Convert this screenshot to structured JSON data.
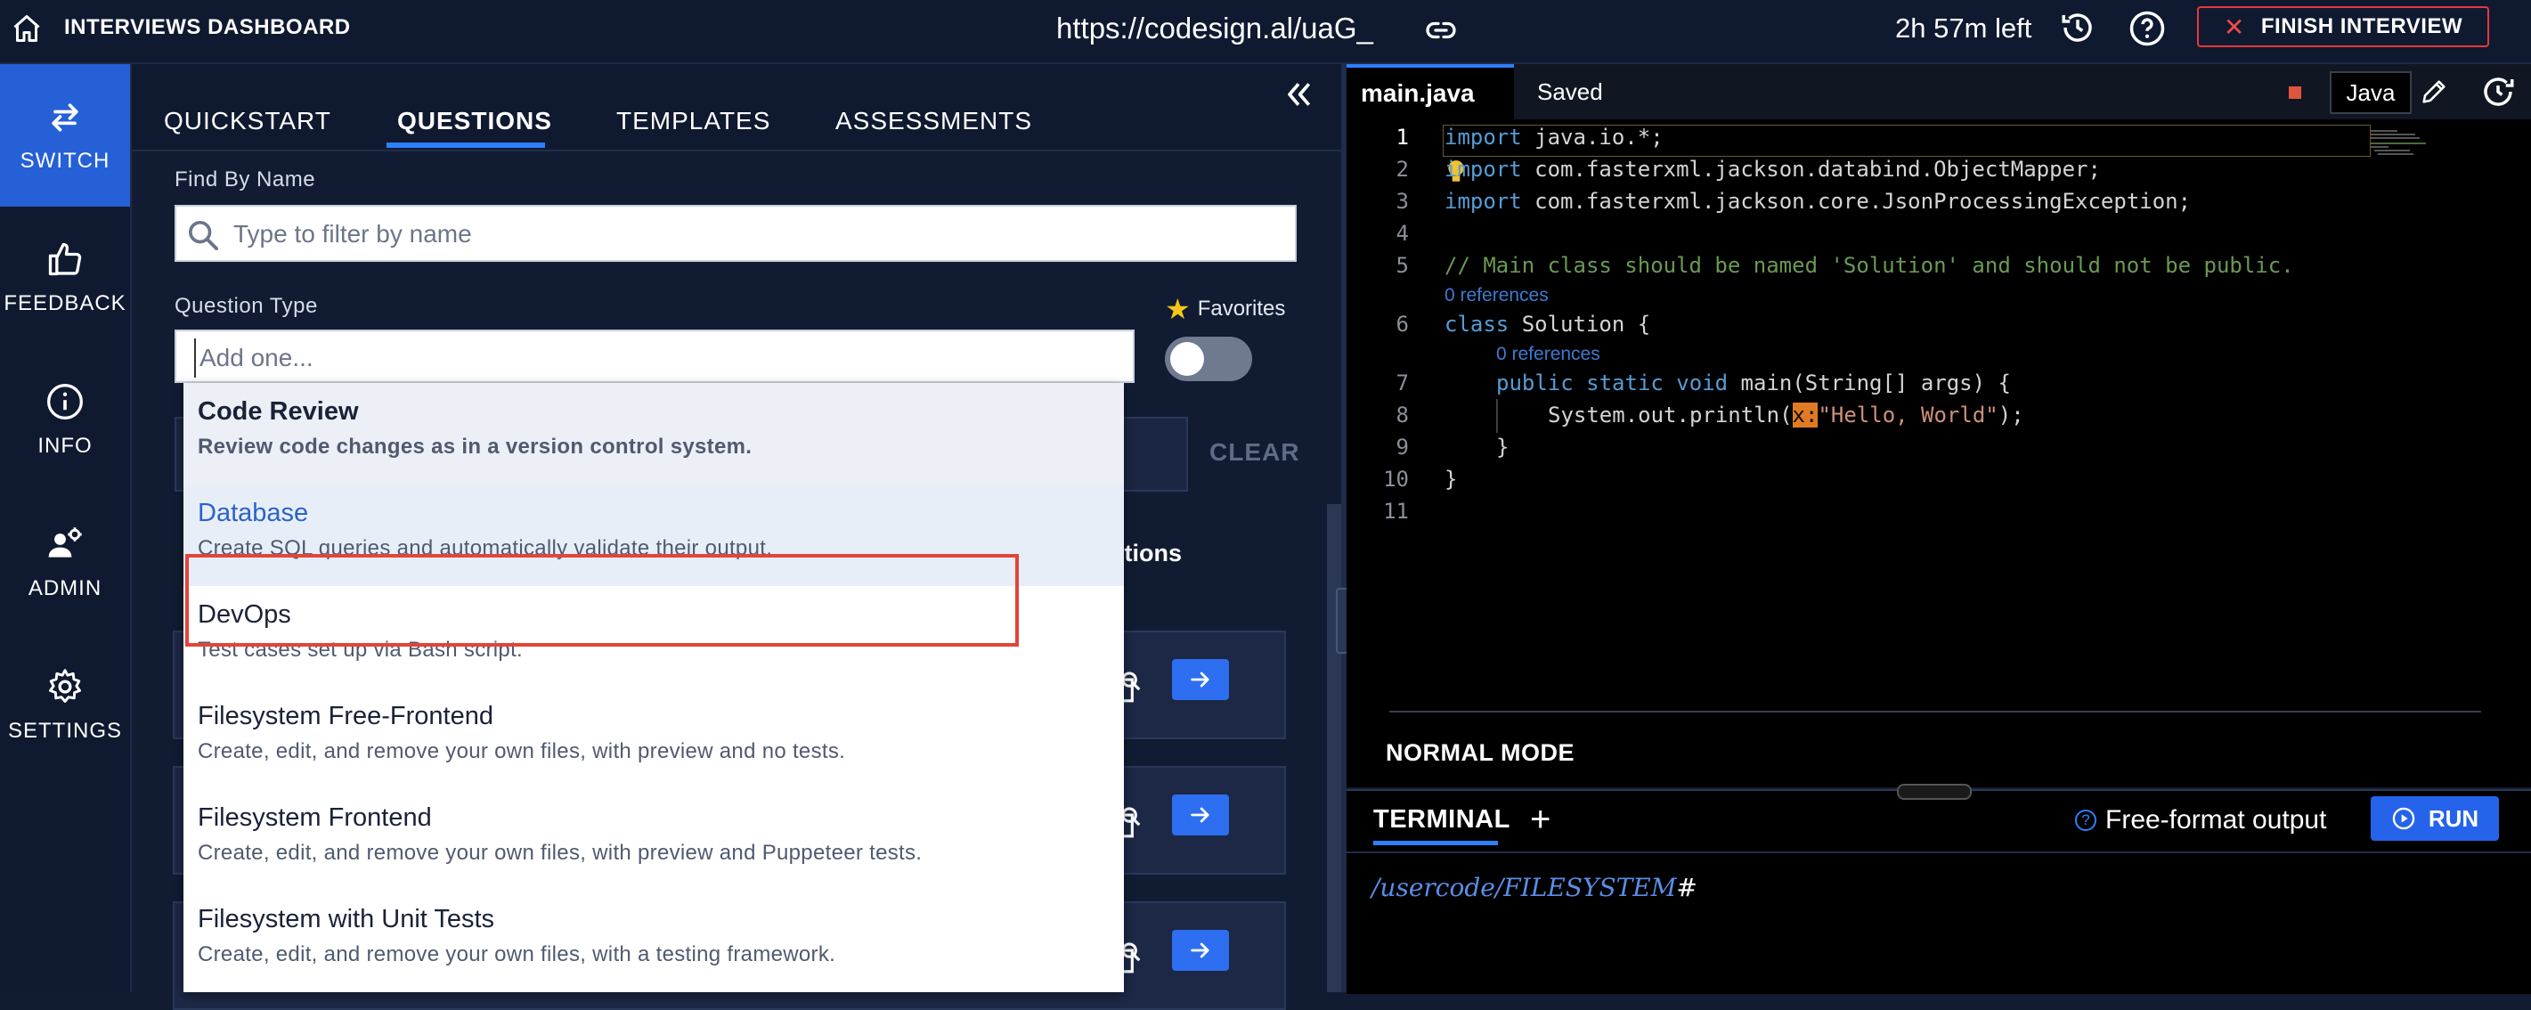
{
  "header": {
    "app_title": "INTERVIEWS DASHBOARD",
    "url": "https://codesign.al/uaG_",
    "time_left": "2h 57m left",
    "finish_label": "FINISH INTERVIEW",
    "finish_icon": "close-icon"
  },
  "rail": {
    "items": [
      {
        "label": "SWITCH",
        "icon": "switch-arrows-icon",
        "active": true
      },
      {
        "label": "FEEDBACK",
        "icon": "thumbs-up-icon"
      },
      {
        "label": "INFO",
        "icon": "info-icon"
      },
      {
        "label": "ADMIN",
        "icon": "admin-gear-user-icon"
      },
      {
        "label": "SETTINGS",
        "icon": "gear-icon"
      }
    ]
  },
  "panel": {
    "tabs": [
      {
        "label": "QUICKSTART"
      },
      {
        "label": "QUESTIONS",
        "active": true
      },
      {
        "label": "TEMPLATES"
      },
      {
        "label": "ASSESSMENTS"
      }
    ],
    "find_label": "Find By Name",
    "search_placeholder": "Type to filter by name",
    "question_type_label": "Question Type",
    "type_placeholder": "Add one...",
    "favorites_label": "Favorites",
    "favorites_on": false,
    "clear_label": "CLEAR",
    "actions_label": "Actions",
    "options": [
      {
        "title": "Code Review",
        "desc": "Review code changes as in a version control system."
      },
      {
        "title": "Database",
        "desc": "Create SQL queries and automatically validate their output.",
        "highlighted": true
      },
      {
        "title": "DevOps",
        "desc": "Test cases set up via Bash script."
      },
      {
        "title": "Filesystem Free-Frontend",
        "desc": "Create, edit, and remove your own files, with preview and no tests."
      },
      {
        "title": "Filesystem Frontend",
        "desc": "Create, edit, and remove your own files, with preview and Puppeteer tests."
      },
      {
        "title": "Filesystem with Unit Tests",
        "desc": "Create, edit, and remove your own files, with a testing framework."
      }
    ]
  },
  "editor": {
    "file_name": "main.java",
    "saved_label": "Saved",
    "language": "Java",
    "line_numbers": [
      "1",
      "2",
      "3",
      "4",
      "5",
      "6",
      "7",
      "8",
      "9",
      "10",
      "11"
    ],
    "code": {
      "l1_kw": "import",
      "l1_rest": " java.io.*;",
      "l2_kw": "import",
      "l2_rest": " com.fasterxml.jackson.databind.ObjectMapper;",
      "l3_kw": "import",
      "l3_rest": " com.fasterxml.jackson.core.JsonProcessingException;",
      "l5_comment": "// Main class should be named 'Solution' and should not be public.",
      "ref_label": "0 references",
      "l6_kw": "class",
      "l6_rest": " Solution {",
      "l7_kw": "public static void",
      "l7_rest": " main(String[] args) {",
      "l8_pre": "System.out.println(",
      "l8_hint": "x:",
      "l8_str": "\"Hello, World\"",
      "l8_post": ");",
      "l9": "}",
      "l10": "}"
    },
    "mode": "NORMAL MODE"
  },
  "terminal": {
    "tab_label": "TERMINAL",
    "output_mode": "Free-format output",
    "run_label": "RUN",
    "prompt_path": "/usercode/FILESYSTEM",
    "prompt_symbol": "#"
  },
  "colors": {
    "accent": "#2d7ff9",
    "danger": "#e23b3b",
    "rail_active": "#2560d6",
    "background": "#111c33"
  }
}
